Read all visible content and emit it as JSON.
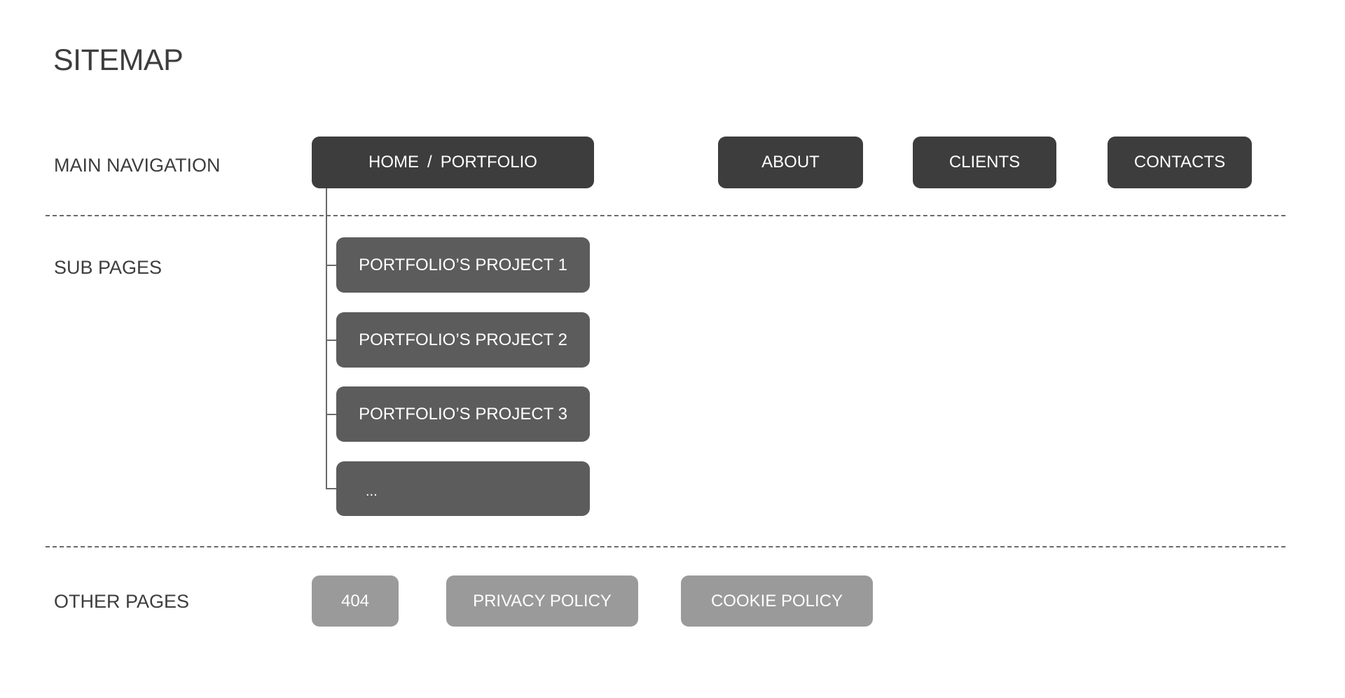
{
  "title": "SITEMAP",
  "sections": {
    "main_navigation": {
      "label": "MAIN NAVIGATION",
      "items": [
        {
          "label": "HOME",
          "separator": "/",
          "label2": "PORTFOLIO"
        },
        {
          "label": "ABOUT"
        },
        {
          "label": "CLIENTS"
        },
        {
          "label": "CONTACTS"
        }
      ]
    },
    "sub_pages": {
      "label": "SUB PAGES",
      "parent": "HOME / PORTFOLIO",
      "items": [
        {
          "label": "PORTFOLIO’S PROJECT 1"
        },
        {
          "label": "PORTFOLIO’S PROJECT 2"
        },
        {
          "label": "PORTFOLIO’S PROJECT 3"
        },
        {
          "label": "..."
        }
      ]
    },
    "other_pages": {
      "label": "OTHER PAGES",
      "items": [
        {
          "label": "404"
        },
        {
          "label": "PRIVACY POLICY"
        },
        {
          "label": "COOKIE POLICY"
        }
      ]
    }
  },
  "colors": {
    "main_nav_node": "#3d3d3d",
    "sub_page_node": "#5c5c5c",
    "other_page_node": "#9a9a9a",
    "text_dark": "#3d3d3d",
    "node_text": "#ffffff",
    "divider": "#6a6a6a"
  }
}
